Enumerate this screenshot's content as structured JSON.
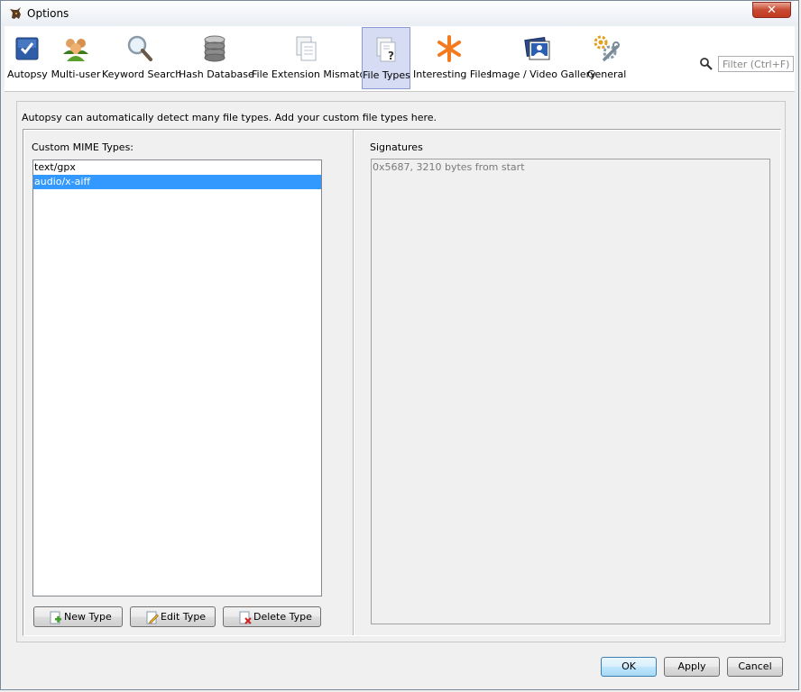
{
  "window": {
    "title": "Options",
    "close_glyph": "✕"
  },
  "toolbar": {
    "items": [
      {
        "label": "Autopsy",
        "icon": "autopsy-checkbox-icon"
      },
      {
        "label": "Multi-user",
        "icon": "users-icon"
      },
      {
        "label": "Keyword Search",
        "icon": "magnifier-icon"
      },
      {
        "label": "Hash Database",
        "icon": "database-icon"
      },
      {
        "label": "File Extension Mismatch",
        "icon": "document-stack-icon"
      },
      {
        "label": "File Types",
        "icon": "file-question-icon",
        "selected": true
      },
      {
        "label": "Interesting Files",
        "icon": "asterisk-icon"
      },
      {
        "label": "Image / Video Gallery",
        "icon": "gallery-icon"
      },
      {
        "label": "General",
        "icon": "gears-wrench-icon"
      }
    ],
    "filter_placeholder": "Filter (Ctrl+F)"
  },
  "file_types": {
    "description": "Autopsy can automatically detect many file types. Add your custom file types here.",
    "custom_mime_label": "Custom MIME Types:",
    "mime_types": [
      {
        "value": "text/gpx",
        "selected": false
      },
      {
        "value": "audio/x-aiff",
        "selected": true
      }
    ],
    "new_type_label": "New Type",
    "edit_type_label": "Edit Type",
    "delete_type_label": "Delete Type",
    "signatures_label": "Signatures",
    "signatures": [
      "0x5687, 3210 bytes from start"
    ]
  },
  "dialog_buttons": {
    "ok": "OK",
    "apply": "Apply",
    "cancel": "Cancel"
  },
  "colors": {
    "selection": "#3399ff",
    "selected_tab_bg": "#d5dcf4",
    "accent_orange": "#f47a20"
  }
}
